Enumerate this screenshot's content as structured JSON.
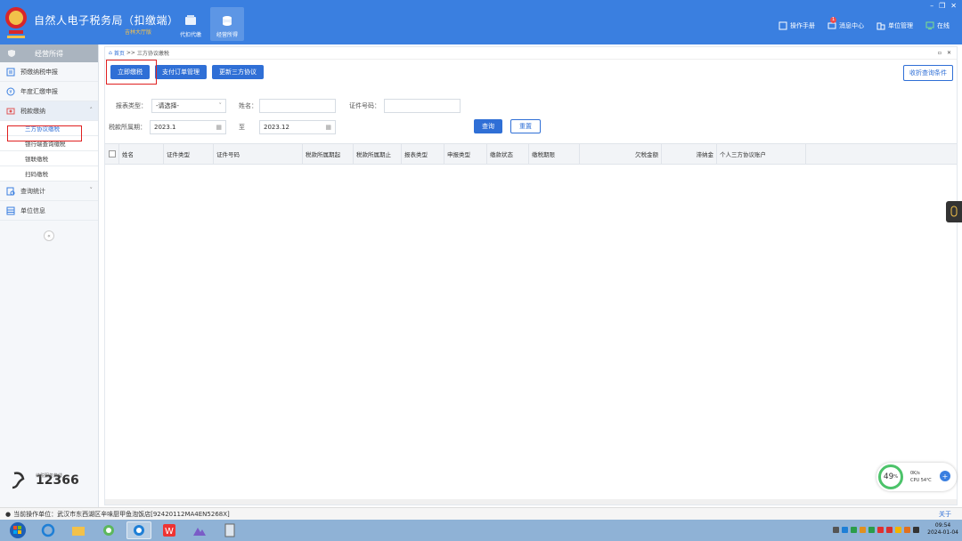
{
  "header": {
    "title": "自然人电子税务局（扣缴端）",
    "subtitle": "吉林大厅版",
    "nav": [
      {
        "label": "代扣代缴",
        "icon": "wallet-icon"
      },
      {
        "label": "经营所得",
        "icon": "coins-icon",
        "active": true
      }
    ],
    "links": [
      {
        "label": "操作手册",
        "icon": "manual-icon"
      },
      {
        "label": "消息中心",
        "icon": "message-icon",
        "badge": "1"
      },
      {
        "label": "单位管理",
        "icon": "building-icon"
      },
      {
        "label": "在线",
        "icon": "online-icon"
      }
    ],
    "window_controls": [
      "–",
      "❐",
      "✕"
    ]
  },
  "sidebar": {
    "heading": "经营所得",
    "items": [
      {
        "label": "预缴纳税申报",
        "icon": "form-icon"
      },
      {
        "label": "年度汇缴申报",
        "icon": "yearly-icon"
      },
      {
        "label": "税款缴纳",
        "icon": "tax-icon",
        "expanded": true,
        "children": [
          {
            "label": "三方协议缴税",
            "active": true
          },
          {
            "label": "银行端查询缴税"
          },
          {
            "label": "银联缴税"
          },
          {
            "label": "扫码缴税"
          }
        ]
      },
      {
        "label": "查询统计",
        "icon": "search-icon"
      },
      {
        "label": "单位信息",
        "icon": "table-icon"
      }
    ],
    "collapse": "«",
    "hotline_label": "纳税服务热线",
    "hotline_number": "12366"
  },
  "breadcrumb": {
    "home": "首页",
    "separator": ">>",
    "current": "三方协议缴税"
  },
  "panel_controls": [
    "▫",
    "✕"
  ],
  "toolbar": {
    "pay_now": "立即缴税",
    "pay_orders": "支付订单管理",
    "update_agreement": "更新三方协议",
    "collapse_conditions": "收折查询条件"
  },
  "form": {
    "report_type_label": "报表类型：",
    "report_type_value": "-请选择-",
    "name_label": "姓名：",
    "name_value": "",
    "id_label": "证件号码：",
    "id_value": "",
    "period_label": "税款所属期：",
    "period_start": "2023.1",
    "to_label": "至",
    "period_end": "2023.12",
    "query": "查询",
    "reset": "重置"
  },
  "table": {
    "columns": [
      "姓名",
      "证件类型",
      "证件号码",
      "税款所属期起",
      "税款所属期止",
      "报表类型",
      "申报类型",
      "缴款状态",
      "缴税期限",
      "欠税金额",
      "滞纳金",
      "个人三方协议账户"
    ],
    "rows": []
  },
  "statusbar": {
    "unit_text": "当前操作单位：武汉市东西湖区辛味厨甲鱼泡饭店[92420112MA4EN5268X]",
    "close": "关于"
  },
  "perf": {
    "percent": "49",
    "unit": "%",
    "net": "0K/s",
    "cpu": "CPU 54℃"
  },
  "clock": {
    "time": "09:54",
    "date": "2024-01-04"
  },
  "colors": {
    "header": "#3a7fe0",
    "accent": "#2f6fd6",
    "highlight": "#e02020"
  }
}
